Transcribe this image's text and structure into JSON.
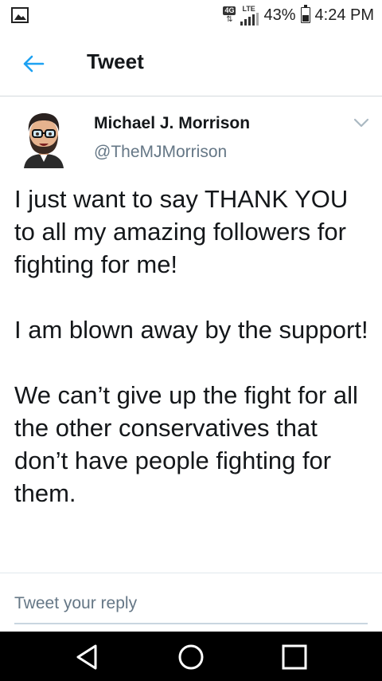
{
  "status_bar": {
    "network_type": "4G",
    "lte_label": "LTE",
    "battery_percent": "43%",
    "battery_level": 0.43,
    "time": "4:24 PM",
    "left_icon": "image-icon"
  },
  "header": {
    "title": "Tweet",
    "back_icon": "back-arrow-icon",
    "accent_color": "#1da1f2"
  },
  "tweet": {
    "author_name": "Michael J. Morrison",
    "author_handle": "@TheMJMorrison",
    "paragraphs": [
      "I just want to say THANK YOU to all my amazing followers for fighting for me!",
      "I am blown away by the support!",
      "We can’t give up the fight for all the other conservatives that don’t have people fighting for them."
    ]
  },
  "reply": {
    "placeholder": "Tweet your reply"
  },
  "nav_bar": {
    "back_icon": "nav-back-icon",
    "home_icon": "nav-home-icon",
    "recents_icon": "nav-recents-icon"
  }
}
